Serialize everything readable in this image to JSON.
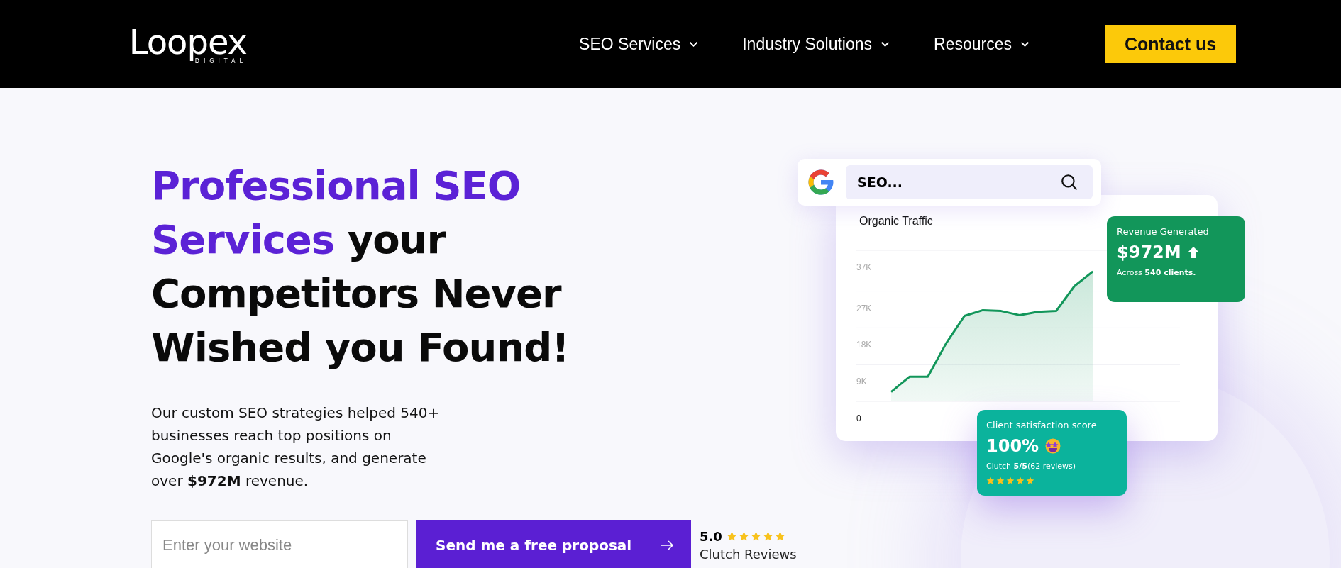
{
  "header": {
    "logo": {
      "name": "Loopex",
      "tagline": "DIGITAL"
    },
    "nav": [
      {
        "label": "SEO Services"
      },
      {
        "label": "Industry Solutions"
      },
      {
        "label": "Resources"
      }
    ],
    "cta": "Contact us"
  },
  "hero": {
    "headline": {
      "highlight": "Professional SEO Services",
      "rest": "your Competitors Never Wished you Found!"
    },
    "description": "Our custom SEO strategies helped 540+ businesses reach top positions on Google's organic results, and generate over **$972M** revenue.",
    "form": {
      "placeholder": "Enter your website",
      "button": "Send me a free proposal"
    },
    "rating": {
      "score": "5.0",
      "stars": 5,
      "label": "Clutch Reviews"
    }
  },
  "visual": {
    "search": {
      "value": "SEO..."
    },
    "chart": {
      "title": "Organic Traffic",
      "chart_data": {
        "type": "area",
        "ylim": [
          0,
          37
        ],
        "yticks": [
          {
            "value": 0,
            "label": "0"
          },
          {
            "value": 9,
            "label": "9K"
          },
          {
            "value": 18,
            "label": "18K"
          },
          {
            "value": 27,
            "label": "27K"
          },
          {
            "value": 37,
            "label": "37K"
          }
        ],
        "series": [
          {
            "color": "#12965a",
            "values": [
              6.5,
              10.2,
              10.2,
              18.4,
              25.1,
              26.5,
              26.3,
              25.3,
              26.1,
              26.3,
              32.4,
              36.0,
              null
            ]
          }
        ]
      }
    },
    "revenue": {
      "title": "Revenue Generated",
      "value": "$972M",
      "note": "Across **540 clients.**"
    },
    "satisfaction": {
      "title": "Client satisfaction score",
      "value": "100%",
      "note": "Clutch **5/5**(62 reviews)",
      "stars": 5
    }
  }
}
